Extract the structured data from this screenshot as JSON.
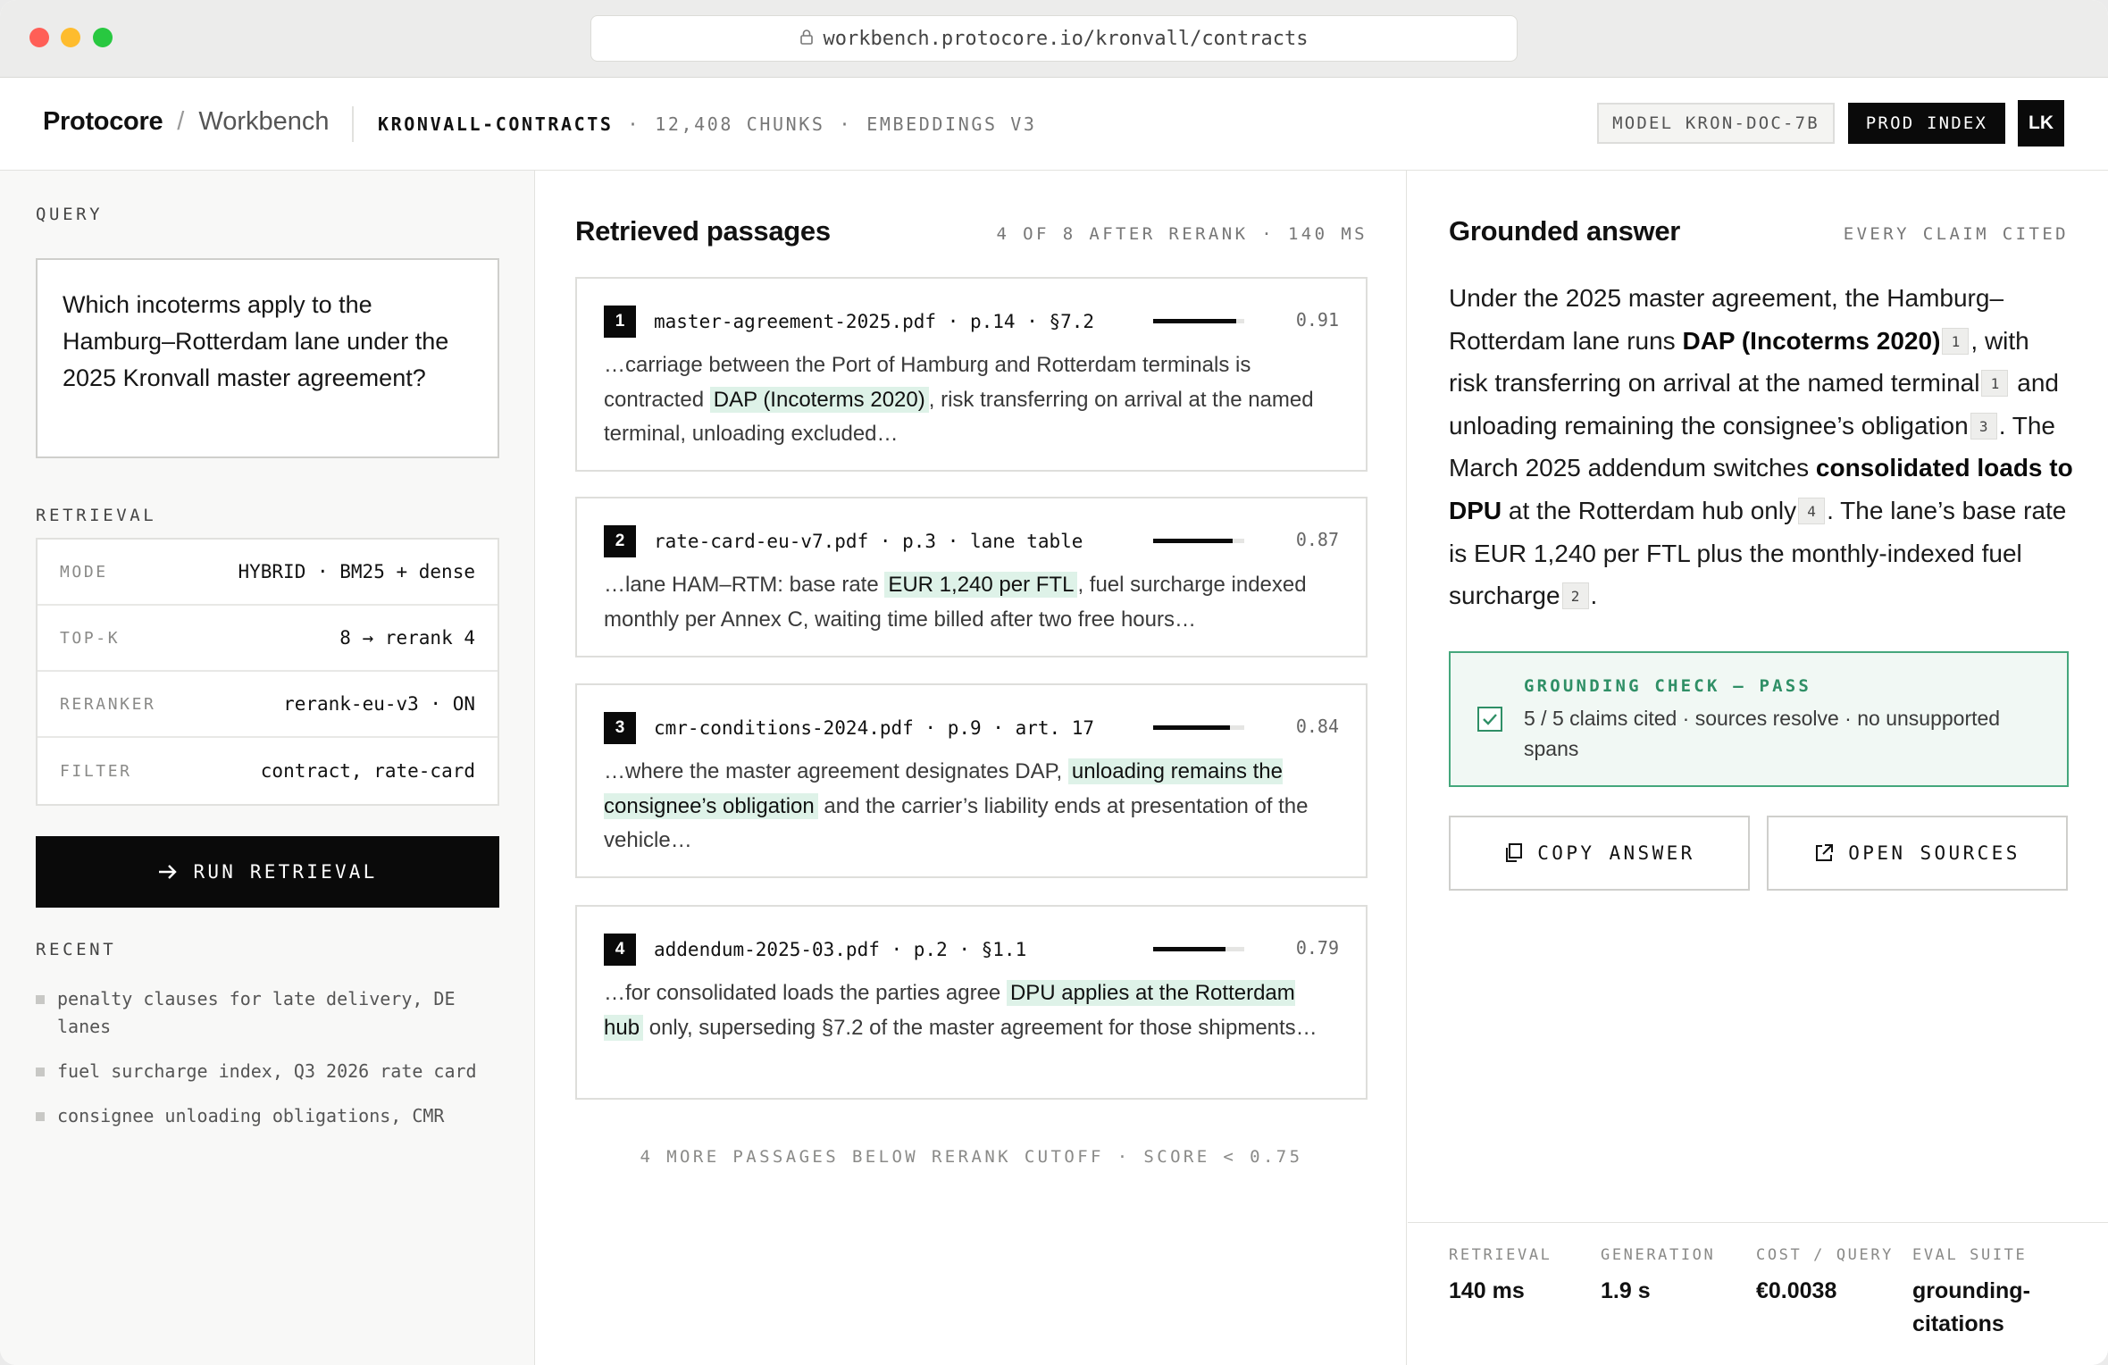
{
  "browser": {
    "url": "workbench.protocore.io/kronvall/contracts"
  },
  "header": {
    "brand": "Protocore",
    "separator": "/",
    "section": "Workbench",
    "corpus_name": "KRONVALL-CONTRACTS",
    "corpus_chunks": "12,408 CHUNKS",
    "corpus_embeddings": "EMBEDDINGS V3",
    "meta_dot": "·",
    "model_badge": "MODEL KRON-DOC-7B",
    "index_badge": "PROD INDEX",
    "avatar": "LK"
  },
  "sidebar": {
    "query_label": "QUERY",
    "query_text": "Which incoterms apply to the Hamburg–Rotterdam lane under the 2025 Kronvall master agreement?",
    "retrieval_label": "RETRIEVAL",
    "retrieval": [
      {
        "key": "MODE",
        "value": "HYBRID · BM25 + dense"
      },
      {
        "key": "TOP-K",
        "value": "8 → rerank 4"
      },
      {
        "key": "RERANKER",
        "value": "rerank-eu-v3 · ON"
      },
      {
        "key": "FILTER",
        "value": "contract, rate-card"
      }
    ],
    "run_button": "RUN RETRIEVAL",
    "recent_label": "RECENT",
    "recent": [
      "penalty clauses for late delivery, DE lanes",
      "fuel surcharge index, Q3 2026 rate card",
      "consignee unloading obligations, CMR"
    ]
  },
  "passages": {
    "title": "Retrieved passages",
    "meta": "4 OF 8 AFTER RERANK · 140 MS",
    "items": [
      {
        "num": "1",
        "source": "master-agreement-2025.pdf · p.14 · §7.2",
        "score": 0.91,
        "score_label": "0.91",
        "pre": "…carriage between the Port of Hamburg and Rotterdam terminals is contracted ",
        "highlight": "DAP (Incoterms 2020)",
        "post": ", risk transferring on arrival at the named terminal, unloading excluded…"
      },
      {
        "num": "2",
        "source": "rate-card-eu-v7.pdf · p.3 · lane table",
        "score": 0.87,
        "score_label": "0.87",
        "pre": "…lane HAM–RTM: base rate ",
        "highlight": "EUR 1,240 per FTL",
        "post": ", fuel surcharge indexed monthly per Annex C, waiting time billed after two free hours…"
      },
      {
        "num": "3",
        "source": "cmr-conditions-2024.pdf · p.9 · art. 17",
        "score": 0.84,
        "score_label": "0.84",
        "pre": "…where the master agreement designates DAP, ",
        "highlight": "unloading remains the consignee’s obligation",
        "post": " and the carrier’s liability ends at presentation of the vehicle…"
      },
      {
        "num": "4",
        "source": "addendum-2025-03.pdf · p.2 · §1.1",
        "score": 0.79,
        "score_label": "0.79",
        "pre": "…for consolidated loads the parties agree ",
        "highlight": "DPU applies at the Rotterdam hub",
        "post": " only, superseding §7.2 of the master agreement for those shipments…"
      }
    ],
    "footer": "4 MORE PASSAGES BELOW RERANK CUTOFF · SCORE < 0.75"
  },
  "answer": {
    "title": "Grounded answer",
    "meta": "EVERY CLAIM CITED",
    "t1": "Under the 2025 master agreement, the Hamburg–Rotterdam lane runs ",
    "b1": "DAP (Incoterms 2020)",
    "c1": "1",
    "t2": ", with risk transferring on arrival at the named terminal",
    "c2": "1",
    "t3": " and unloading remaining the consignee’s obligation",
    "c3": "3",
    "t4": ". The March 2025 addendum switches ",
    "b2": "consolidated loads to DPU",
    "t5": " at the Rotterdam hub only",
    "c4": "4",
    "t6": ". The lane’s base rate is EUR 1,240 per FTL plus the monthly-indexed fuel surcharge",
    "c5": "2",
    "t7": ".",
    "check_title": "GROUNDING CHECK — PASS",
    "check_body": "5 / 5 claims cited · sources resolve · no unsupported spans",
    "copy_button": "COPY ANSWER",
    "open_button": "OPEN SOURCES"
  },
  "stats": [
    {
      "label": "RETRIEVAL",
      "value": "140 ms"
    },
    {
      "label": "GENERATION",
      "value": "1.9 s"
    },
    {
      "label": "COST / QUERY",
      "value": "€0.0038"
    },
    {
      "label": "EVAL SUITE",
      "value": "grounding-citations"
    }
  ],
  "colors": {
    "accent_green": "#2f8f66",
    "highlight": "#def2e8",
    "ink": "#0a0a0a"
  }
}
